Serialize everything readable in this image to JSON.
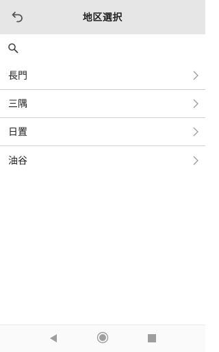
{
  "header": {
    "title": "地区選択",
    "back_icon": "undo-arrow-icon"
  },
  "search": {
    "icon": "search-icon",
    "placeholder": "",
    "value": ""
  },
  "list": {
    "items": [
      {
        "label": "長門",
        "icon": "chevron-right-icon"
      },
      {
        "label": "三隅",
        "icon": "chevron-right-icon"
      },
      {
        "label": "日置",
        "icon": "chevron-right-icon"
      },
      {
        "label": "油谷",
        "icon": "chevron-right-icon"
      }
    ]
  },
  "navbar": {
    "back_icon": "nav-back-icon",
    "home_icon": "nav-home-icon",
    "recent_icon": "nav-recent-apps-icon"
  },
  "colors": {
    "header_bg": "#e6e6e6",
    "divider": "#d0d0d0",
    "chevron": "#9e9e9e",
    "nav_icon": "#9e9e9e"
  }
}
